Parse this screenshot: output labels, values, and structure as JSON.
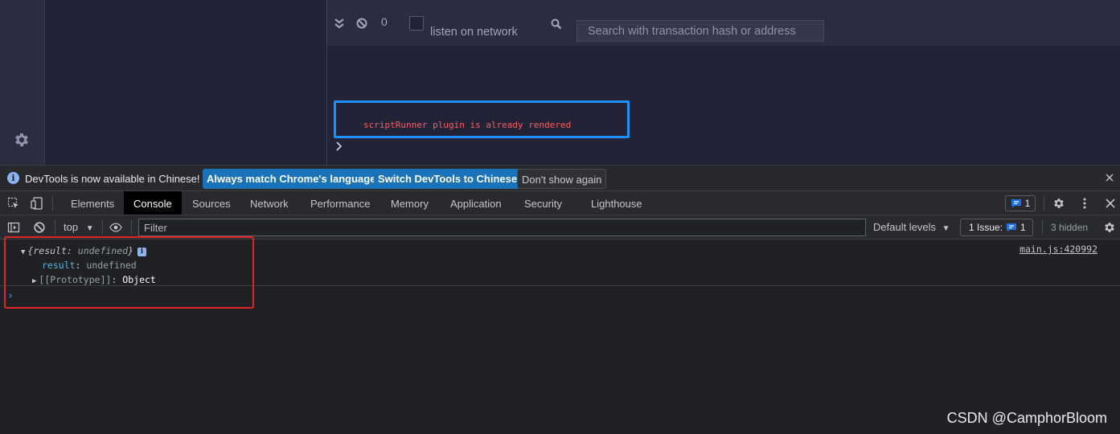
{
  "app": {
    "terminal": {
      "count": "0",
      "listen_label": "listen on network",
      "search_placeholder": "Search with transaction hash or address",
      "message": "scriptRunner plugin is already rendered"
    }
  },
  "devtools": {
    "infobar": {
      "text": "DevTools is now available in Chinese!",
      "btn_match": "Always match Chrome's language",
      "btn_switch": "Switch DevTools to Chinese",
      "btn_dismiss": "Don't show again"
    },
    "tabs": [
      "Elements",
      "Console",
      "Sources",
      "Network",
      "Performance",
      "Memory",
      "Application",
      "Security",
      "Lighthouse"
    ],
    "active_tab": "Console",
    "issues_badge_count": "1",
    "toolbar": {
      "context": "top",
      "filter_placeholder": "Filter",
      "levels": "Default levels",
      "issue_label": "1 Issue:",
      "issue_count": "1",
      "hidden": "3 hidden"
    },
    "console": {
      "source": "main.js:420992",
      "summary_open": "{",
      "summary_key": "result",
      "summary_sep": ": ",
      "summary_value": "undefined",
      "summary_close": "}",
      "info_badge": "i",
      "prop_key": "result",
      "prop_sep": ": ",
      "prop_value": "undefined",
      "proto_key": "[[Prototype]]",
      "proto_sep": ": ",
      "proto_value": "Object"
    }
  },
  "watermark": "CSDN @CamphorBloom",
  "colors": {
    "accent_blue": "#1a73b8",
    "highlight_box": "#1e90ff",
    "error_text": "#ff5c5c",
    "annotation_red": "#e02424"
  }
}
